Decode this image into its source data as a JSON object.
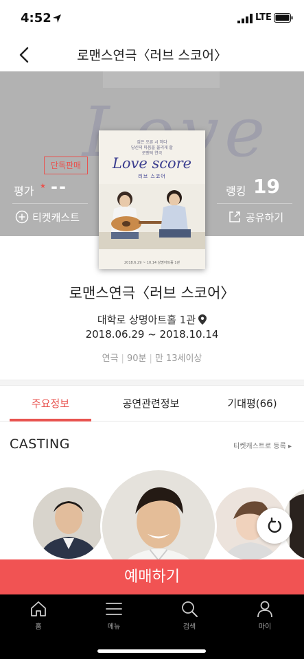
{
  "status_bar": {
    "time": "4:52",
    "network": "LTE"
  },
  "header": {
    "title": "로맨스연극〈러브 스코어〉"
  },
  "hero": {
    "background_text": "Love",
    "badge": "단독판매",
    "rating_label": "평가",
    "rating_value": "--",
    "ranking_label": "랭킹",
    "ranking_value": "19",
    "ticketcast_label": "티켓캐스트",
    "share_label": "공유하기"
  },
  "poster": {
    "subtitle": "검은 오른 시 하다\n당신의 마음을 울리게 할\n로맨틱 연극",
    "title": "Love score",
    "title_kr": "러브 스코어",
    "footer": "2018.6.29 ~ 10.14     상명아트홀 1관"
  },
  "show": {
    "title": "로맨스연극〈러브 스코어〉",
    "venue": "대학로 상명아트홀 1관",
    "dates": "2018.06.29 ~ 2018.10.14",
    "genre": "연극",
    "runtime": "90분",
    "age_limit": "만 13세이상"
  },
  "tabs": [
    {
      "label": "주요정보",
      "active": true
    },
    {
      "label": "공연관련정보",
      "active": false
    },
    {
      "label": "기대평(66)",
      "active": false
    }
  ],
  "casting": {
    "title": "CASTING",
    "link_label": "티켓캐스트로 등록 ▸"
  },
  "buy_button": "예매하기",
  "bottom_nav": [
    {
      "label": "홈",
      "icon": "home-icon"
    },
    {
      "label": "메뉴",
      "icon": "menu-icon"
    },
    {
      "label": "검색",
      "icon": "search-icon"
    },
    {
      "label": "마이",
      "icon": "person-icon"
    }
  ],
  "colors": {
    "accent": "#e8534f",
    "buy_button": "#f15353",
    "hero_overlay": "#b2b2b2",
    "bottom_nav": "#000000"
  }
}
